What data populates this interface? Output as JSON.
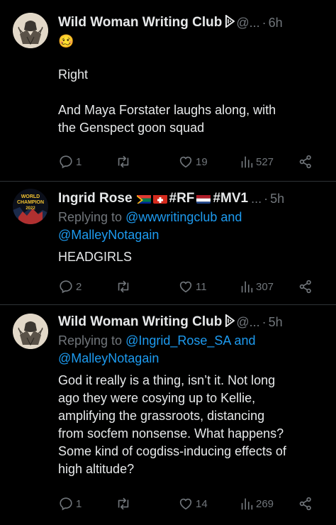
{
  "tweets": [
    {
      "display_name": "Wild Woman Writing Club",
      "handle": "@...",
      "separator": "·",
      "time": "6h",
      "emoji": "🥴",
      "lines": [
        "Right",
        "",
        "And Maya Forstater laughs along, with",
        "the Genspect goon squad"
      ],
      "actions": {
        "reply": "1",
        "retweet": "",
        "like": "19",
        "views": "527"
      }
    },
    {
      "display_name": "Ingrid Rose",
      "flags_text_1": "#RF",
      "flags_text_2": "#MV1",
      "handle": "...",
      "separator": "·",
      "time": "5h",
      "replying_prefix": "Replying to",
      "replying_mention_1": "@wwwritingclub",
      "replying_and": "and",
      "replying_mention_2": "@MalleyNotagain",
      "lines": [
        "HEADGIRLS"
      ],
      "actions": {
        "reply": "2",
        "retweet": "",
        "like": "11",
        "views": "307"
      }
    },
    {
      "display_name": "Wild Woman Writing Club",
      "handle": "@...",
      "separator": "·",
      "time": "5h",
      "replying_prefix": "Replying to",
      "replying_mention_1": "@Ingrid_Rose_SA",
      "replying_and": "and",
      "replying_mention_2": "@MalleyNotagain",
      "lines": [
        "God it really is a thing, isn’t it. Not long",
        "ago they were cosying up to Kellie,",
        "amplifying the grassroots, distancing",
        "from socfem nonsense. What happens?",
        "Some kind of cogdiss-inducing effects of",
        "high altitude?"
      ],
      "actions": {
        "reply": "1",
        "retweet": "",
        "like": "14",
        "views": "269"
      }
    }
  ],
  "avatar2_text": [
    "WORLD",
    "CHAMPION",
    "2022"
  ],
  "colors": {
    "background": "#000000",
    "text": "#e7e9ea",
    "muted": "#71767b",
    "link": "#1d9bf0",
    "divider": "#2f3336"
  },
  "icons": [
    "reply-icon",
    "retweet-icon",
    "like-icon",
    "views-icon",
    "share-icon",
    "verified-badge-icon",
    "flag-icon"
  ]
}
